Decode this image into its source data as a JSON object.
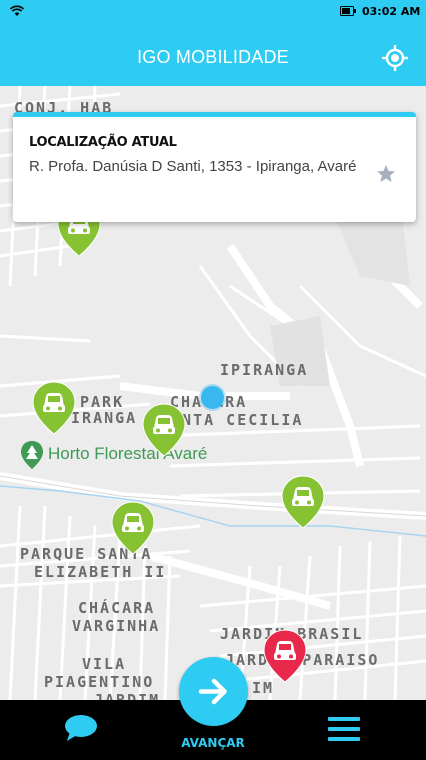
{
  "status_bar": {
    "time": "03:02 AM",
    "icons": [
      "wifi-icon",
      "battery-icon"
    ]
  },
  "header": {
    "title": "IGO MOBILIDADE",
    "action_icon": "locate-icon"
  },
  "location_card": {
    "label": "LOCALIZAÇÃO ATUAL",
    "address": "R. Profa. Danúsia D Santi, 1353  -  Ipiranga, Avaré",
    "favorite_icon": "star-icon"
  },
  "map": {
    "labels": {
      "con_hab": "CONJ. HAB",
      "ipiranga": "IPIRANGA",
      "park": "PARK",
      "piranga": "PIRANGA",
      "chacara_1": "CHACARA",
      "santa_cecilia": "SANTA CECILIA",
      "parque_santa": "PARQUE SANTA",
      "elizabeth": "ELIZABETH II",
      "chacara_2": "CHÁCARA",
      "varginha": "VARGINHA",
      "jardim_brasil": "JARDIM BRASIL",
      "jardim_paraiso": "JARDIM PARAISO",
      "vila": "VILA",
      "piagentino": "PIAGENTINO",
      "jardim_partial": "JARDIM",
      "im": "IM"
    },
    "poi": "Horto Florestal Avaré",
    "markers": {
      "available_color": "#86c232",
      "selected_color": "#e8294b"
    }
  },
  "bottom_nav": {
    "chat_icon": "chat-icon",
    "advance_label": "AVANÇAR",
    "menu_icon": "menu-icon"
  },
  "colors": {
    "primary": "#2ecbf2",
    "marker_green": "#86c232",
    "marker_red": "#e8294b"
  }
}
